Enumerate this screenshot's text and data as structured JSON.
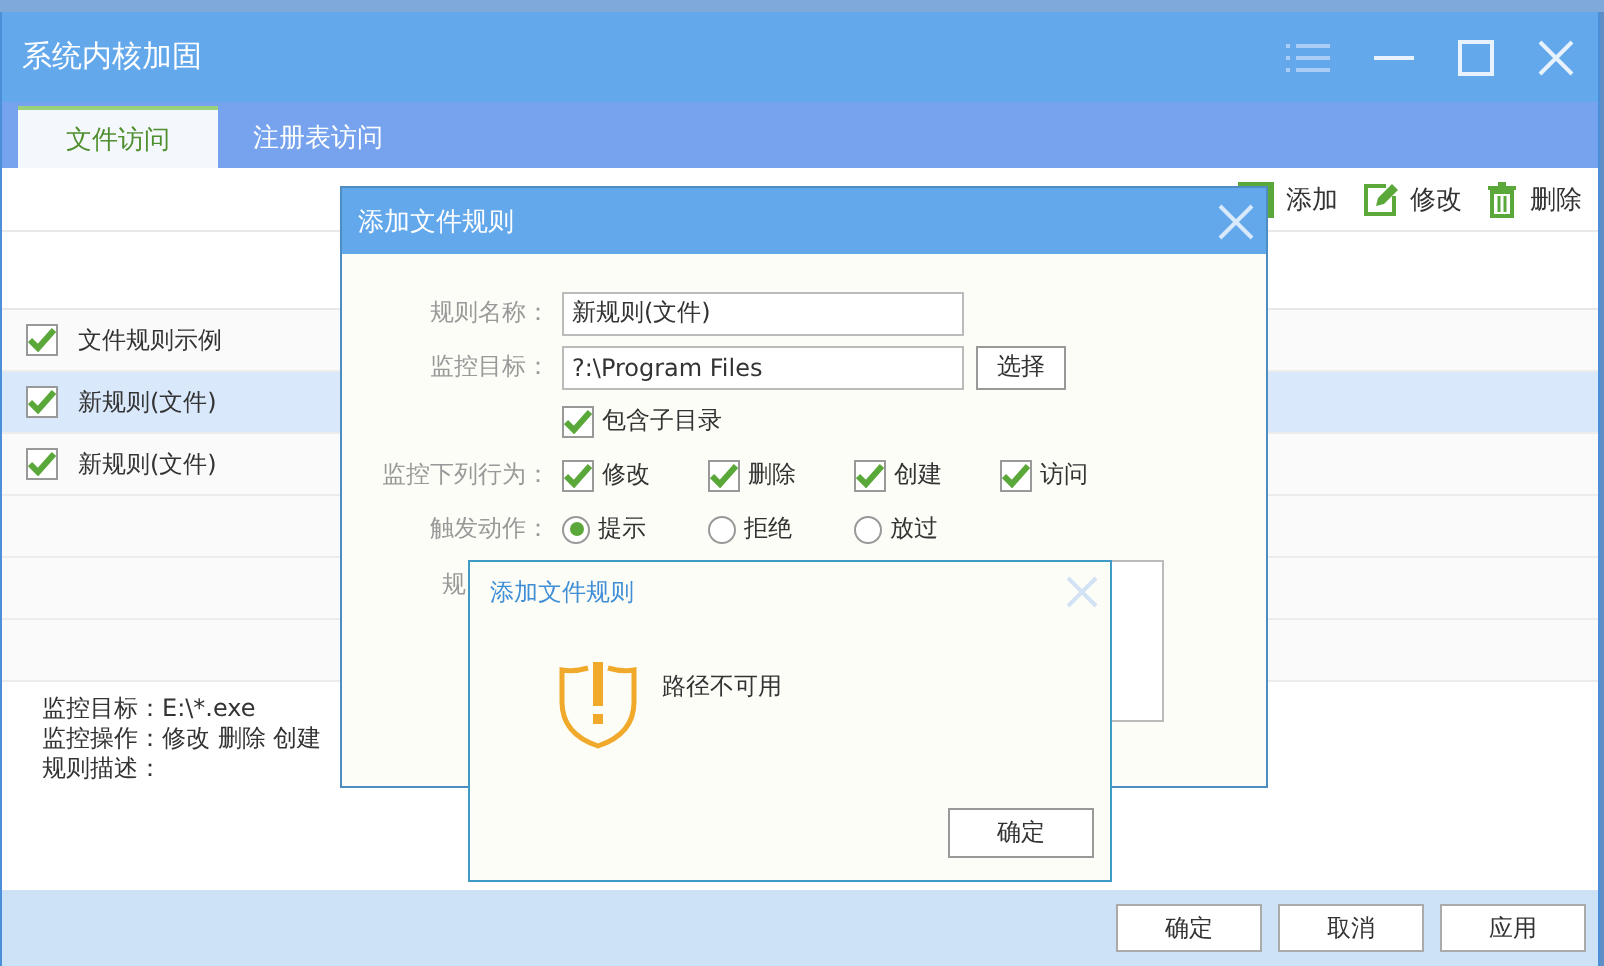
{
  "window": {
    "title": "系统内核加固"
  },
  "tabs": [
    {
      "label": "文件访问",
      "selected": true
    },
    {
      "label": "注册表访问",
      "selected": false
    }
  ],
  "toolbar": [
    {
      "kind": "add",
      "label": "添加"
    },
    {
      "kind": "edit",
      "label": "修改"
    },
    {
      "kind": "delete",
      "label": "删除"
    }
  ],
  "rules": [
    {
      "name": "文件规则示例",
      "checked": true,
      "selected": false
    },
    {
      "name": "新规则(文件)",
      "checked": true,
      "selected": true
    },
    {
      "name": "新规则(文件)",
      "checked": true,
      "selected": false
    }
  ],
  "details": [
    "监控目标：E:\\*.exe",
    "监控操作：修改 删除 创建",
    "规则描述："
  ],
  "footer_buttons": [
    "确定",
    "取消",
    "应用"
  ],
  "rule_dialog": {
    "title": "添加文件规则",
    "name_label": "规则名称：",
    "name_value": "新规则(文件)",
    "target_label": "监控目标：",
    "target_value": "?:\\Program Files",
    "browse_button": "选择",
    "subdirs": {
      "label": "包含子目录",
      "checked": true
    },
    "behavior_label": "监控下列行为：",
    "behaviors": [
      {
        "label": "修改",
        "checked": true
      },
      {
        "label": "删除",
        "checked": true
      },
      {
        "label": "创建",
        "checked": true
      },
      {
        "label": "访问",
        "checked": true
      }
    ],
    "action_label": "触发动作：",
    "actions": [
      {
        "label": "提示",
        "selected": true
      },
      {
        "label": "拒绝",
        "selected": false
      },
      {
        "label": "放过",
        "selected": false
      }
    ],
    "desc_label": "规"
  },
  "alert": {
    "title": "添加文件规则",
    "message": "路径不可用",
    "button": "确定"
  }
}
